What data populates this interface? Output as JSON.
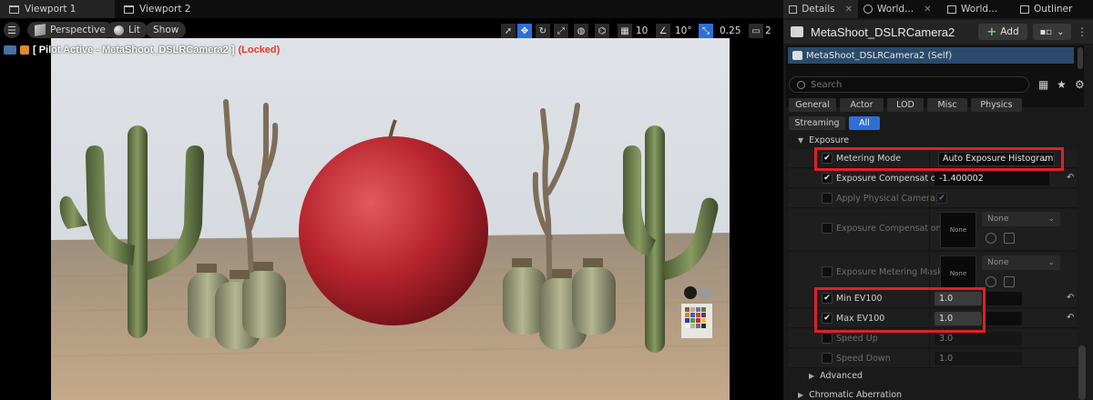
{
  "viewport_tabs": [
    {
      "label": "Viewport 1",
      "active": true
    },
    {
      "label": "Viewport 2",
      "active": false
    }
  ],
  "toolbar": {
    "perspective": "Perspective",
    "lit": "Lit",
    "show": "Show",
    "grid_snap": "10",
    "rotation_snap": "10°",
    "scale_snap": "0.25",
    "camera_speed": "2"
  },
  "pilot": {
    "text": "[ Pilot Active - MetaShoot_DSLRCamera2 ]",
    "locked": "(Locked)"
  },
  "details": {
    "tabs": [
      {
        "label": "Details",
        "active": true
      },
      {
        "label": "World...",
        "active": false
      },
      {
        "label": "World...",
        "active": false
      },
      {
        "label": "Outliner",
        "active": false
      }
    ],
    "actor_name": "MetaShoot_DSLRCamera2",
    "add_label": "Add",
    "component_self": "MetaShoot_DSLRCamera2 (Self)",
    "search_placeholder": "Search",
    "filters": [
      "General",
      "Actor",
      "LOD",
      "Misc",
      "Physics",
      "Streaming",
      "All"
    ],
    "active_filter": "All",
    "category_exposure": "Exposure",
    "rows": {
      "metering_mode": {
        "label": "Metering Mode",
        "value": "Auto Exposure Histogram"
      },
      "exposure_comp": {
        "label": "Exposure Compensation",
        "value": "-1.400002"
      },
      "apply_physical": {
        "label": "Apply Physical Camera..."
      },
      "exposure_curve": {
        "label": "Exposure Compensation...",
        "thumb": "None",
        "asset": "None"
      },
      "metering_mask": {
        "label": "Exposure Metering Mask",
        "thumb": "None",
        "asset": "None"
      },
      "min_ev100": {
        "label": "Min EV100",
        "value": "1.0"
      },
      "max_ev100": {
        "label": "Max EV100",
        "value": "1.0"
      },
      "speed_up": {
        "label": "Speed Up",
        "value": "3.0"
      },
      "speed_down": {
        "label": "Speed Down",
        "value": "1.0"
      }
    },
    "advanced_label": "Advanced",
    "chromatic_label": "Chromatic Aberration"
  },
  "colors": {
    "accent": "#2e6fd6",
    "locked": "#e23a2a",
    "highlight": "#e0202a",
    "apple": "#b8242e"
  }
}
